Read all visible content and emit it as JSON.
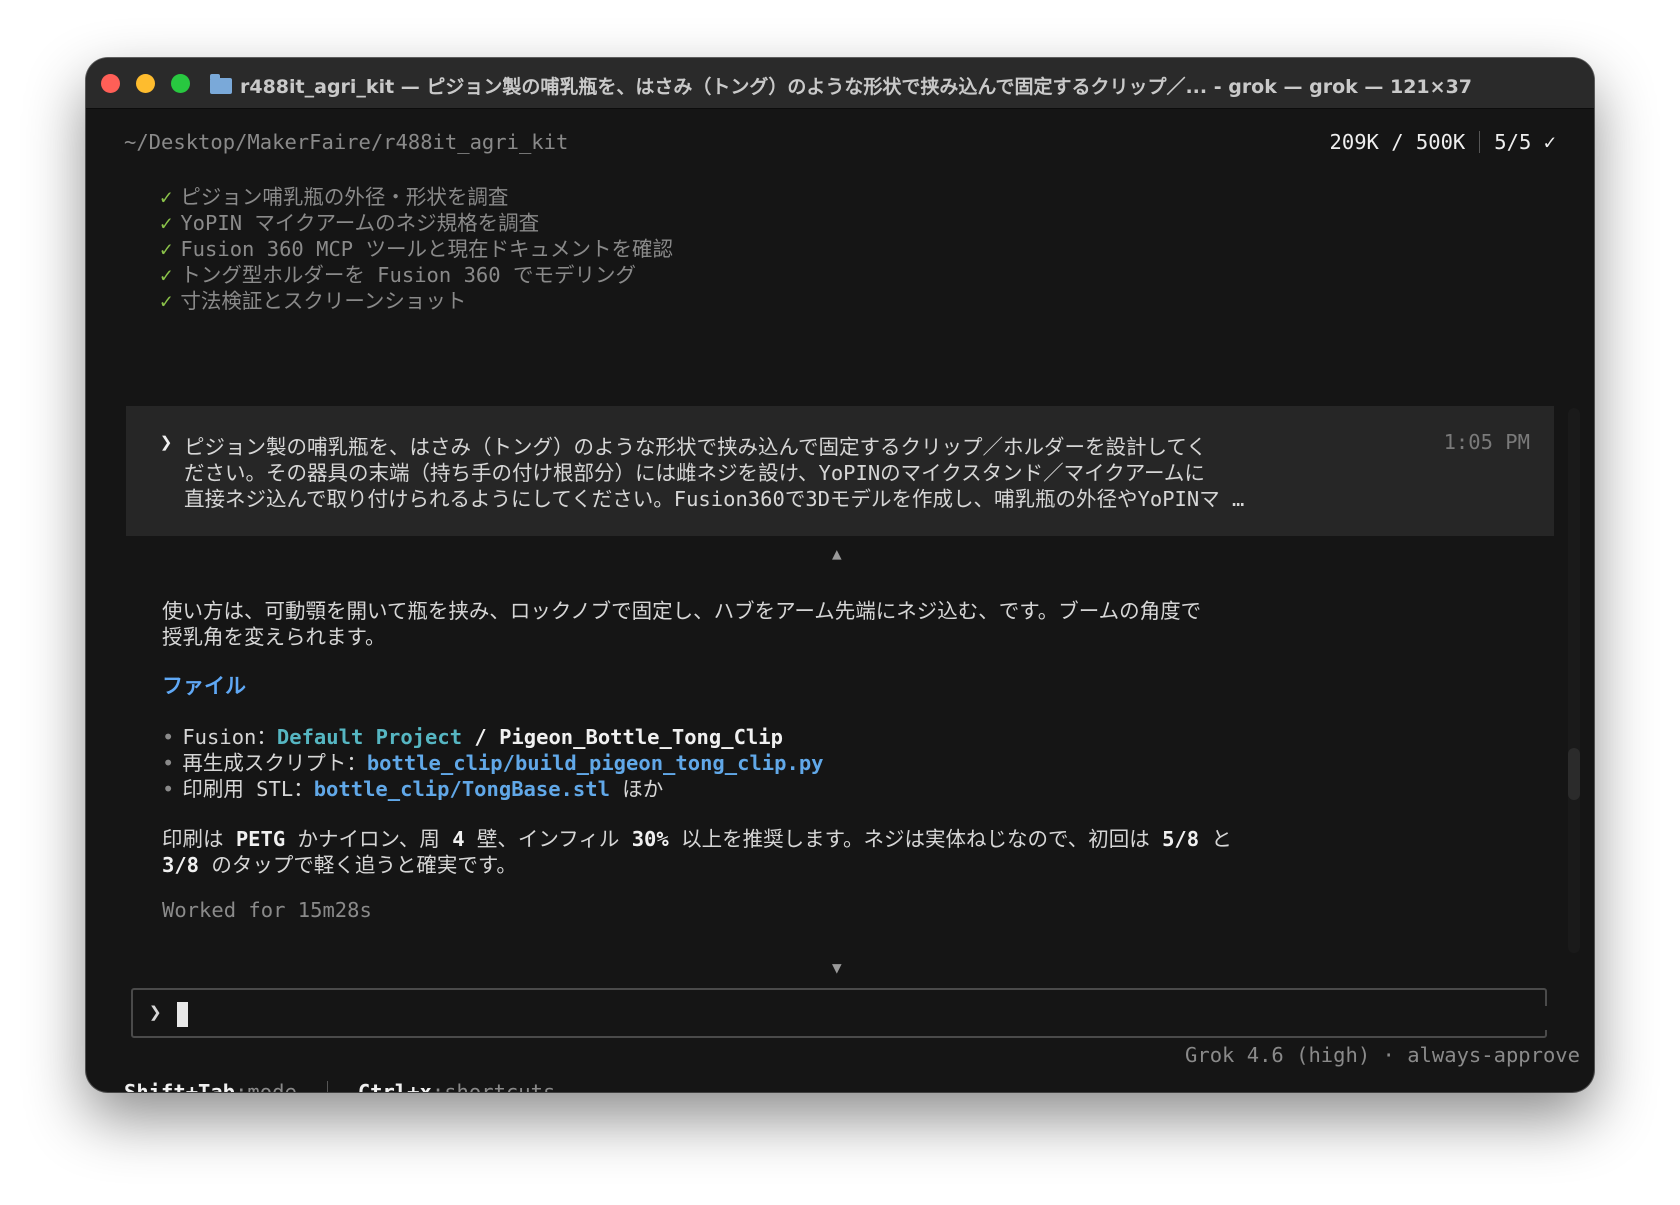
{
  "window": {
    "title": "r488it_agri_kit — ピジョン製の哺乳瓶を、はさみ（トング）のような形状で挟み込んで固定するクリップ／... - grok — grok — 121×37"
  },
  "header": {
    "path": "~/Desktop/MakerFaire/r488it_agri_kit",
    "tokens": "209K / 500K",
    "tasks": "5/5 ✓"
  },
  "tasks": [
    {
      "check": "✓",
      "label": "ピジョン哺乳瓶の外径・形状を調査"
    },
    {
      "check": "✓",
      "label": "YoPIN マイクアームのネジ規格を調査"
    },
    {
      "check": "✓",
      "label": "Fusion 360 MCP ツールと現在ドキュメントを確認"
    },
    {
      "check": "✓",
      "label": "トング型ホルダーを Fusion 360 でモデリング"
    },
    {
      "check": "✓",
      "label": "寸法検証とスクリーンショット"
    }
  ],
  "user_message": {
    "prompt": "❯",
    "time": "1:05 PM",
    "lines": [
      "ピジョン製の哺乳瓶を、はさみ（トング）のような形状で挟み込んで固定するクリップ／ホルダーを設計してく",
      "ださい。その器具の末端（持ち手の付け根部分）には雌ネジを設け、YoPINのマイクスタンド／マイクアームに",
      "直接ネジ込んで取り付けられるようにしてください。Fusion360で3Dモデルを作成し、哺乳瓶の外径やYoPINマ …"
    ]
  },
  "scroll_up": "▲",
  "scroll_down": "▼",
  "response": {
    "intro_lines": [
      "使い方は、可動顎を開いて瓶を挟み、ロックノブで固定し、ハブをアーム先端にネジ込む、です。ブームの角度で",
      "授乳角を変えられます。"
    ],
    "files_heading": "ファイル",
    "files": [
      {
        "bullet": "•",
        "label": "Fusion：",
        "link": "Default Project",
        "sep": " / ",
        "strong": "Pigeon_Bottle_Tong_Clip",
        "suffix": ""
      },
      {
        "bullet": "•",
        "label": "再生成スクリプト：",
        "link": "bottle_clip/build_pigeon_tong_clip.py",
        "sep": "",
        "strong": "",
        "suffix": ""
      },
      {
        "bullet": "•",
        "label": "印刷用 STL：",
        "link": "bottle_clip/TongBase.stl",
        "sep": "",
        "strong": "",
        "suffix": " ほか"
      }
    ],
    "print_lines": [
      {
        "pre": "印刷は ",
        "b1": "PETG",
        "mid1": " かナイロン、周 ",
        "b2": "4",
        "mid2": " 壁、インフィル ",
        "b3": "30%",
        "mid3": " 以上を推奨します。ネジは実体ねじなので、初回は ",
        "b4": "5/8",
        "post": " と"
      },
      {
        "pre": "",
        "b1": "3/8",
        "mid1": " のタップで軽く追うと確実です。",
        "b2": "",
        "mid2": "",
        "b3": "",
        "mid3": "",
        "b4": "",
        "post": ""
      }
    ],
    "worked": "Worked for 15m28s"
  },
  "input": {
    "prompt": "❯",
    "model": "Grok 4.6 (high)",
    "dot": "·",
    "mode": "always-approve"
  },
  "footer": {
    "shift_tab_key": "Shift+Tab",
    "shift_tab_action": ":mode",
    "ctrl_x_key": "Ctrl+x",
    "ctrl_x_action": ":shortcuts"
  }
}
